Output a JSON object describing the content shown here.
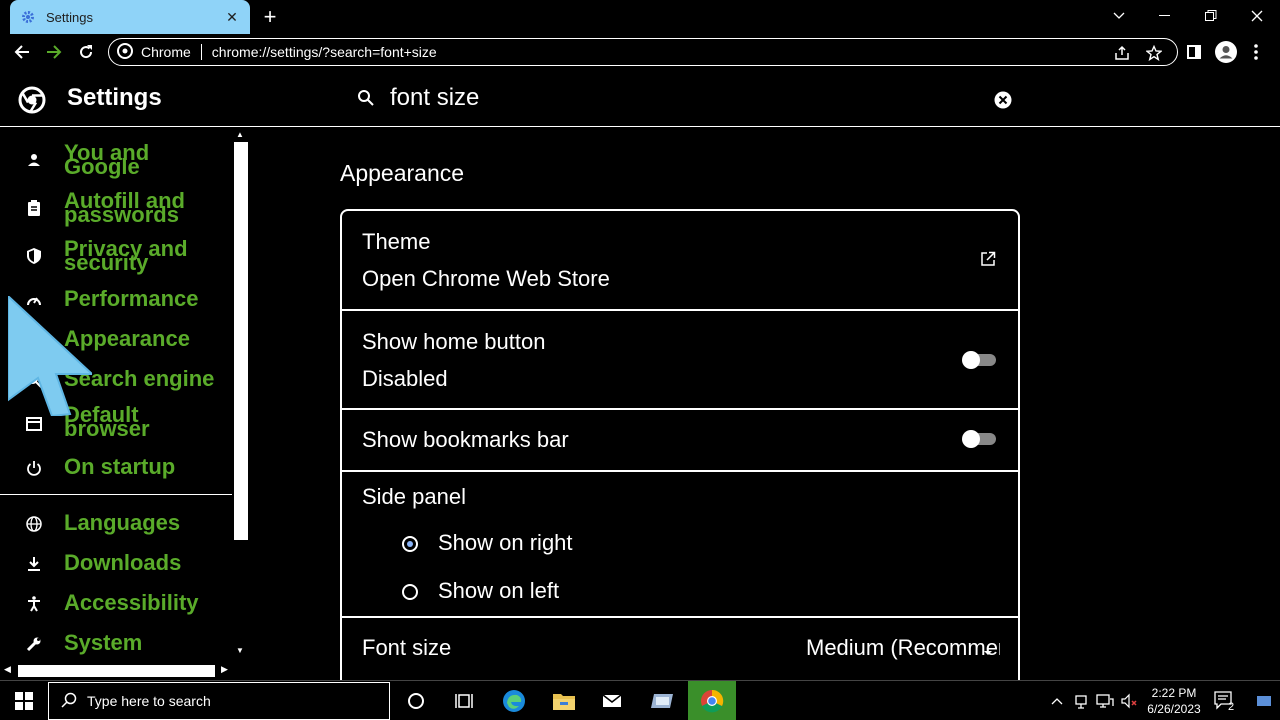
{
  "tab": {
    "title": "Settings",
    "favicon": "gear-icon",
    "close": "close-icon"
  },
  "window": {
    "controls": [
      "chevron-down-icon",
      "minimize-icon",
      "restore-icon",
      "close-icon"
    ]
  },
  "toolbar": {
    "site_chip": "Chrome",
    "url": "chrome://settings/?search=font+size"
  },
  "settings": {
    "title": "Settings",
    "search_value": "font size"
  },
  "sidebar": {
    "items": [
      {
        "label": "You and Google",
        "icon": "person-icon"
      },
      {
        "label": "Autofill and passwords",
        "icon": "clipboard-icon"
      },
      {
        "label": "Privacy and security",
        "icon": "shield-icon"
      },
      {
        "label": "Performance",
        "icon": "speedometer-icon"
      },
      {
        "label": "Appearance",
        "icon": "palette-icon"
      },
      {
        "label": "Search engine",
        "icon": "search-icon"
      },
      {
        "label": "Default browser",
        "icon": "browser-icon"
      },
      {
        "label": "On startup",
        "icon": "power-icon"
      },
      {
        "label": "Languages",
        "icon": "globe-icon"
      },
      {
        "label": "Downloads",
        "icon": "download-icon"
      },
      {
        "label": "Accessibility",
        "icon": "accessibility-icon"
      },
      {
        "label": "System",
        "icon": "wrench-icon"
      }
    ]
  },
  "main": {
    "section_title": "Appearance",
    "theme": {
      "title": "Theme",
      "subtitle": "Open Chrome Web Store"
    },
    "home_button": {
      "title": "Show home button",
      "subtitle": "Disabled",
      "enabled": false
    },
    "bookmarks_bar": {
      "title": "Show bookmarks bar",
      "enabled": false
    },
    "side_panel": {
      "title": "Side panel",
      "options": [
        "Show on right",
        "Show on left"
      ],
      "selected": "Show on right"
    },
    "font_size": {
      "title": "Font size",
      "value": "Medium (Recommended)"
    }
  },
  "taskbar": {
    "search_placeholder": "Type here to search",
    "time": "2:22 PM",
    "date": "6/26/2023",
    "notification_count": "2"
  },
  "colors": {
    "nav_label": "#5aab2a",
    "tab_bg": "#8fd3f8",
    "cursor": "#7ecbf0",
    "active_taskbar": "#3a8f2a"
  }
}
